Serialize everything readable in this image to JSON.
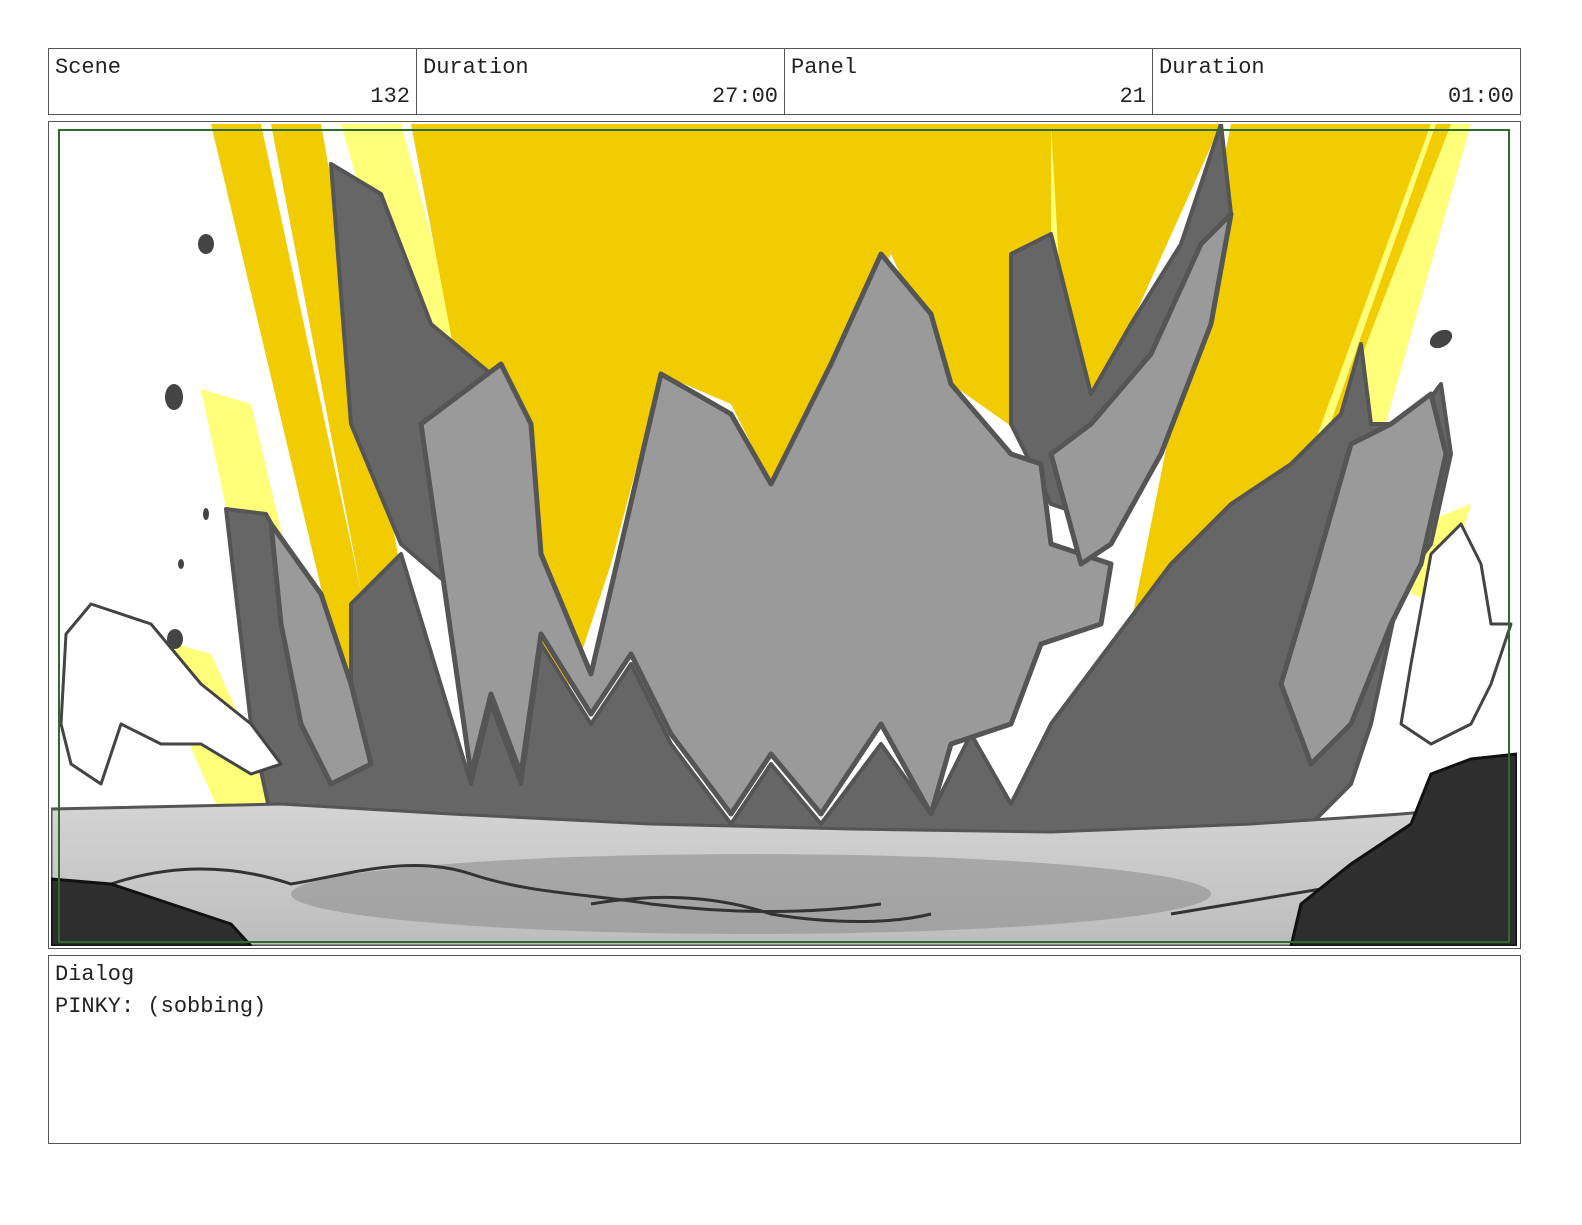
{
  "header": {
    "scene_label": "Scene",
    "scene_value": "132",
    "scene_duration_label": "Duration",
    "scene_duration_value": "27:00",
    "panel_label": "Panel",
    "panel_value": "21",
    "panel_duration_label": "Duration",
    "panel_duration_value": "01:00"
  },
  "dialog": {
    "label": "Dialog",
    "text": "PINKY: (sobbing)"
  },
  "colors": {
    "border": "#555555",
    "safe_frame": "#2e6b2e",
    "explosion_yellow": "#f0cc00",
    "light_yellow": "#ffff7a",
    "rock_light": "#9a9a9a",
    "rock_dark": "#666666",
    "ground": "#c9c9c9",
    "boulder": "#2e2e2e"
  }
}
